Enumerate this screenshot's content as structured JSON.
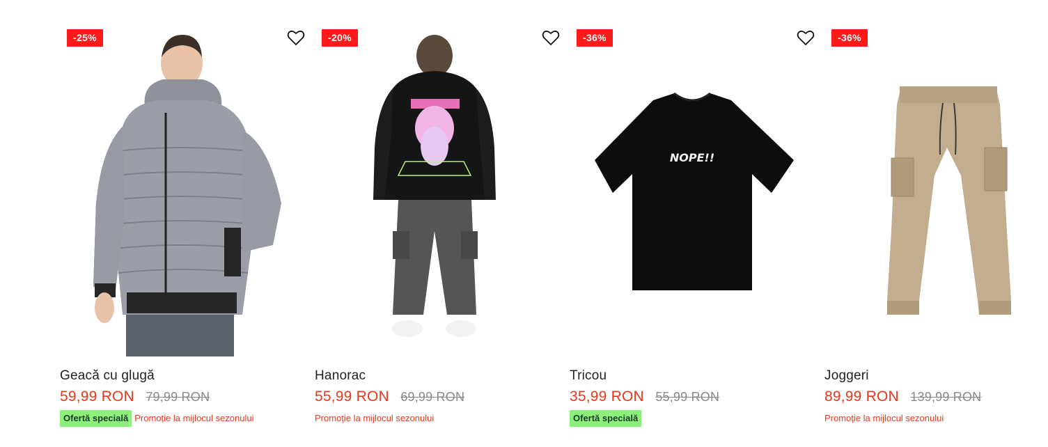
{
  "colors": {
    "badge": "#ff1a1a",
    "price": "#e8381b",
    "special_tag": "#8cf07a",
    "promo_text": "#e8381b"
  },
  "products": [
    {
      "discount": "-25%",
      "title": "Geacă cu glugă",
      "price": "59,99 RON",
      "old_price": "79,99 RON",
      "special_tag": "Ofertă specială",
      "promo": "Promoție la mijlocul sezonului",
      "wishlist_icon": "heart-outline-icon"
    },
    {
      "discount": "-20%",
      "title": "Hanorac",
      "price": "55,99 RON",
      "old_price": "69,99 RON",
      "special_tag": "",
      "promo": "Promoție la mijlocul sezonului",
      "wishlist_icon": "heart-outline-icon"
    },
    {
      "discount": "-36%",
      "title": "Tricou",
      "price": "35,99 RON",
      "old_price": "55,99 RON",
      "special_tag": "Ofertă specială",
      "promo": "",
      "wishlist_icon": "heart-outline-icon"
    },
    {
      "discount": "-36%",
      "title": "Joggeri",
      "price": "89,99 RON",
      "old_price": "139,99 RON",
      "special_tag": "",
      "promo": "Promoție la mijlocul sezonului",
      "wishlist_icon": "heart-outline-icon"
    }
  ]
}
